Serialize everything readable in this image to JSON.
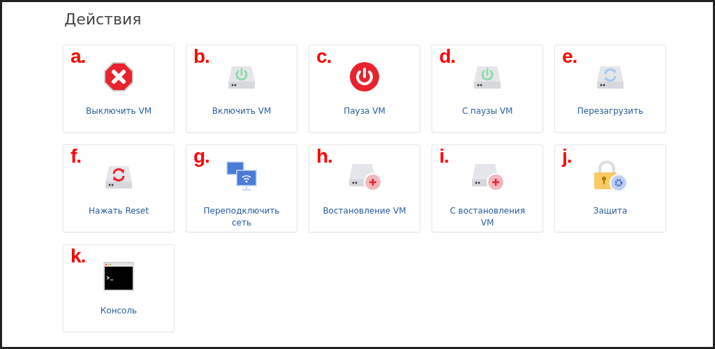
{
  "title": "Действия",
  "actions": [
    {
      "marker": "a.",
      "label": "Выключить VM",
      "kind": "stop"
    },
    {
      "marker": "b.",
      "label": "Включить VM",
      "kind": "drive-power"
    },
    {
      "marker": "c.",
      "label": "Пауза VM",
      "kind": "power"
    },
    {
      "marker": "d.",
      "label": "С паузы VM",
      "kind": "drive-power"
    },
    {
      "marker": "e.",
      "label": "Перезагрузить",
      "kind": "drive-sync"
    },
    {
      "marker": "f.",
      "label": "Нажать Reset",
      "kind": "drive-reset"
    },
    {
      "marker": "g.",
      "label": "Переподключить сеть",
      "kind": "network"
    },
    {
      "marker": "h.",
      "label": "Востановление VM",
      "kind": "drive-plus"
    },
    {
      "marker": "i.",
      "label": "С востановления VM",
      "kind": "drive-plus"
    },
    {
      "marker": "j.",
      "label": "Защита",
      "kind": "lock"
    },
    {
      "marker": "k.",
      "label": "Консоль",
      "kind": "console"
    }
  ]
}
